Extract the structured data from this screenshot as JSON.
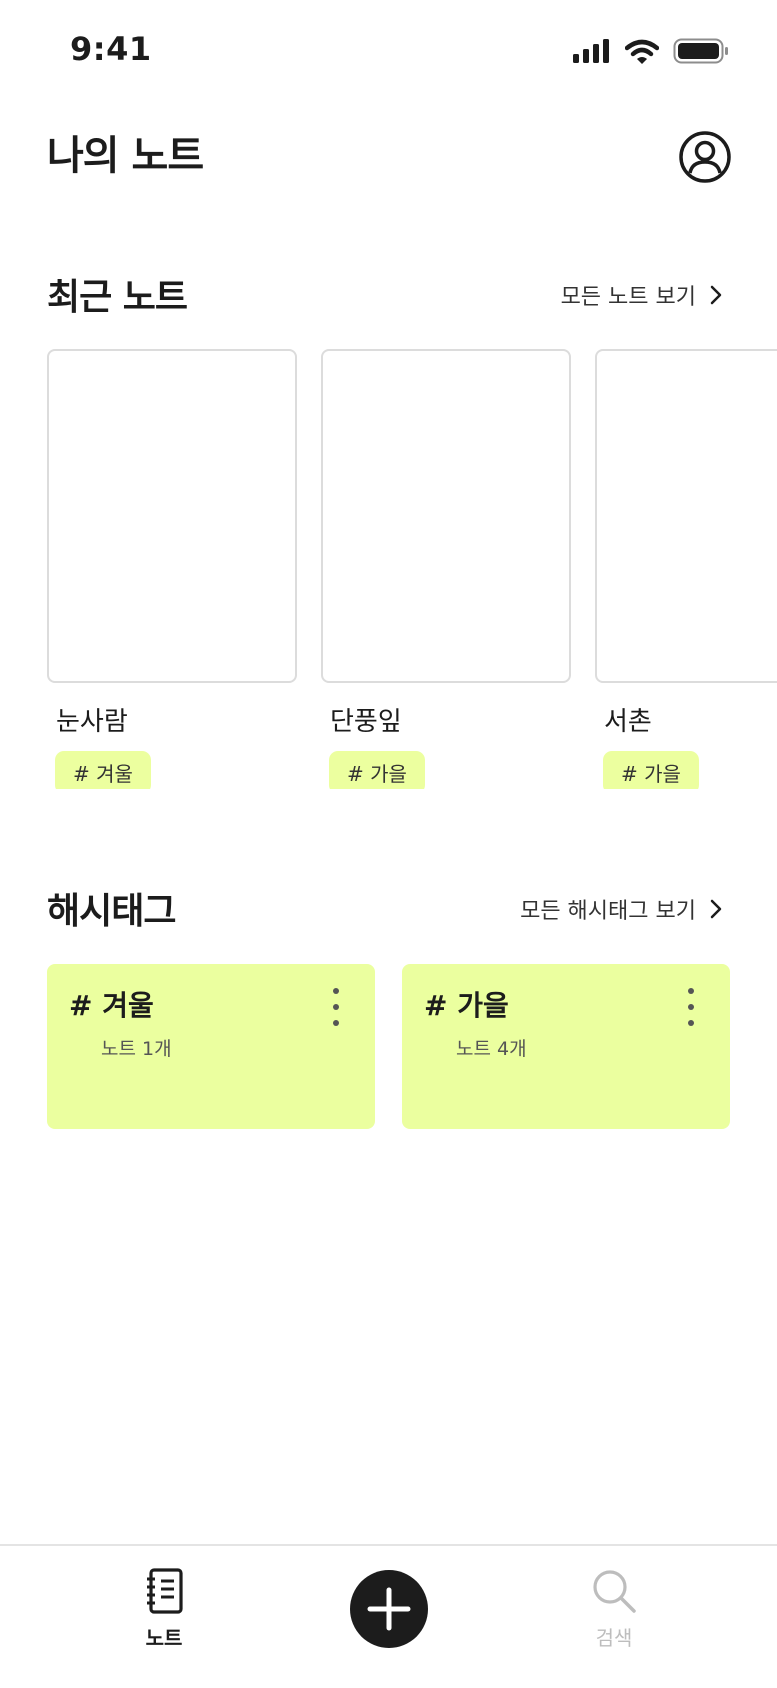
{
  "status_bar": {
    "time": "9:41"
  },
  "header": {
    "title": "나의 노트",
    "profile_icon": "user-circle-icon"
  },
  "recent_section": {
    "title": "최근 노트",
    "see_all_label": "모든 노트 보기",
    "notes": [
      {
        "title": "눈사람",
        "tag": "# 겨울"
      },
      {
        "title": "단풍잎",
        "tag": "# 가을"
      },
      {
        "title": "서촌",
        "tag": "# 가을"
      }
    ]
  },
  "hashtag_section": {
    "title": "해시태그",
    "see_all_label": "모든 해시태그 보기",
    "tags": [
      {
        "name": "# 겨울",
        "count_label": "노트 1개"
      },
      {
        "name": "# 가을",
        "count_label": "노트 4개"
      }
    ]
  },
  "tab_bar": {
    "notes_label": "노트",
    "search_label": "검색",
    "active_tab": "노트"
  },
  "colors": {
    "accent": "#EBFF9F",
    "text_primary": "#1C1C1C",
    "inactive": "#BDBDBD",
    "card_border": "#DCDCDC"
  }
}
